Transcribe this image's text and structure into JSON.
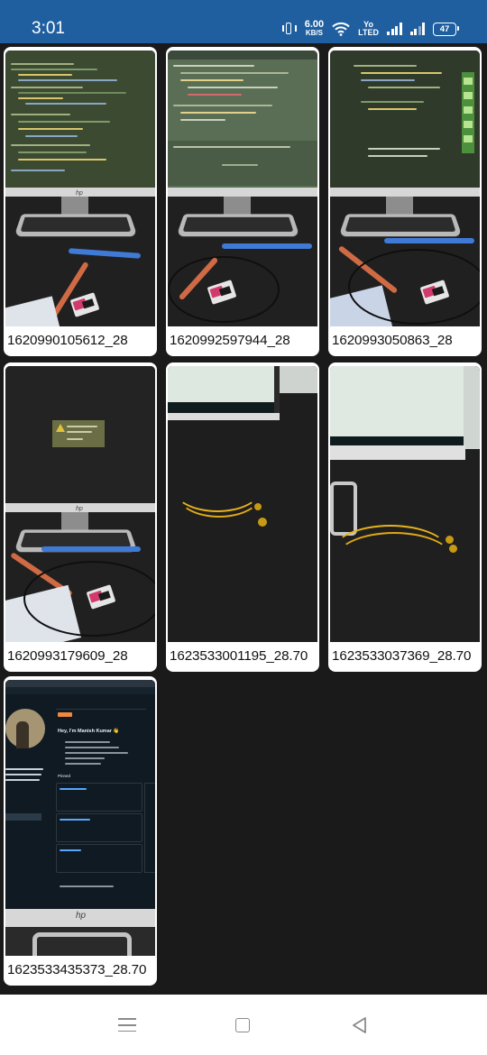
{
  "status_bar": {
    "time": "3:01",
    "net_speed_value": "6.00",
    "net_speed_unit": "KB/S",
    "volte_top": "Yo",
    "volte_bottom": "LTED",
    "battery": "47"
  },
  "gallery": {
    "items": [
      {
        "caption": "1620990105612_28"
      },
      {
        "caption": "1620992597944_28"
      },
      {
        "caption": "1620993050863_28"
      },
      {
        "caption": "1620993179609_28"
      },
      {
        "caption": "1623533001195_28.70"
      },
      {
        "caption": "1623533037369_28.70"
      },
      {
        "caption": "1623533435373_28.70"
      }
    ]
  },
  "photo_text": {
    "greeting": "Hey, I'm Manish Kumar 👋",
    "section": "Pinned",
    "hp_logo": "hp"
  },
  "colors": {
    "status_bar": "#1f5fa0",
    "background": "#1a1a1a",
    "tile": "#ffffff"
  }
}
